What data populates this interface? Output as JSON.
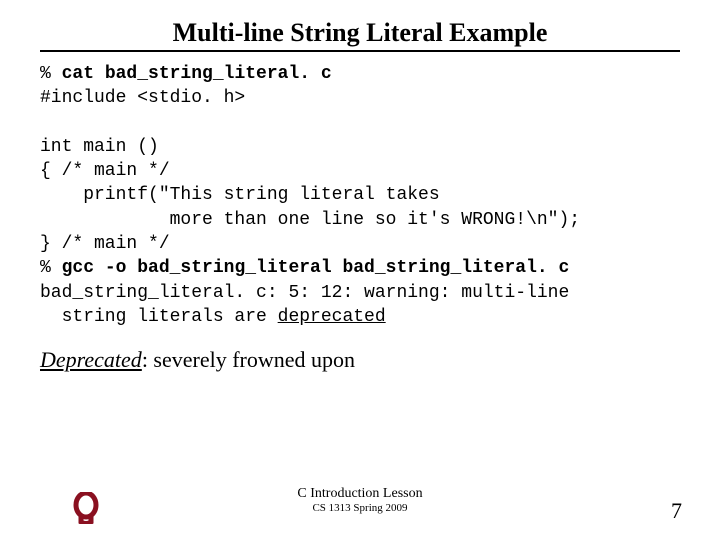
{
  "title": "Multi-line String Literal Example",
  "code": {
    "l1a": "% ",
    "l1b": "cat bad_string_literal. c",
    "l2": "#include <stdio. h>",
    "l3": "",
    "l4": "int main ()",
    "l5": "{ /* main */",
    "l6": "    printf(\"This string literal takes",
    "l7": "            more than one line so it's WRONG!\\n\");",
    "l8": "} /* main */",
    "l9a": "% ",
    "l9b": "gcc -o bad_string_literal bad_string_literal. c",
    "l10": "bad_string_literal. c: 5: 12: warning: multi-line",
    "l11a": "  string literals are ",
    "l11b": "deprecated"
  },
  "body": {
    "term": "Deprecated",
    "rest": ": severely frowned upon"
  },
  "footer": {
    "lesson": "C Introduction Lesson",
    "course": "CS 1313 Spring 2009",
    "page": "7"
  }
}
